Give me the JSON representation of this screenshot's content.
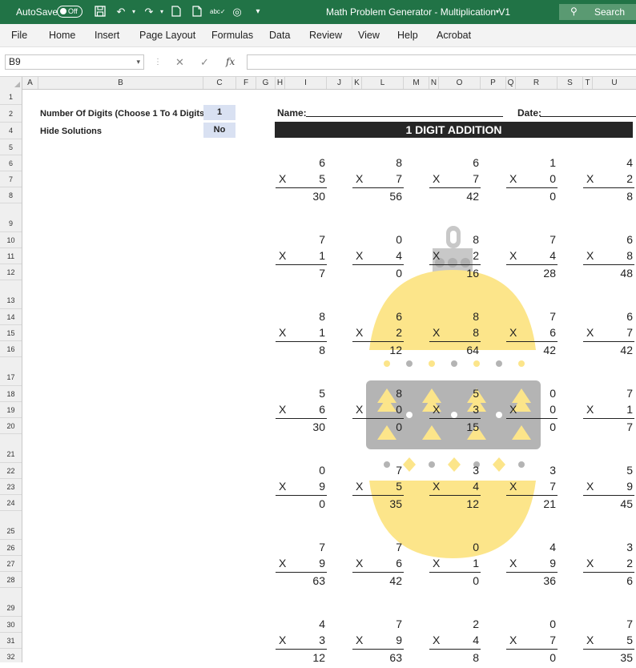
{
  "titlebar": {
    "autosave_label": "AutoSave",
    "autosave_state": "Off",
    "title": "Math Problem Generator - Multiplication V1",
    "search_label": "Search",
    "bg_color": "#217346"
  },
  "ribbon": {
    "tabs": [
      "File",
      "Home",
      "Insert",
      "Page Layout",
      "Formulas",
      "Data",
      "Review",
      "View",
      "Help",
      "Acrobat"
    ]
  },
  "formula_bar": {
    "name_box": "B9",
    "cancel_symbol": "✕",
    "enter_symbol": "✓",
    "fx_symbol": "fx",
    "formula": ""
  },
  "columns": [
    "A",
    "B",
    "C",
    "F",
    "G",
    "H",
    "I",
    "J",
    "K",
    "L",
    "M",
    "N",
    "O",
    "P",
    "Q",
    "R",
    "S",
    "T",
    "U"
  ],
  "rows": [
    "1",
    "2",
    "4",
    "5",
    "6",
    "7",
    "8",
    "9",
    "10",
    "11",
    "12",
    "13",
    "14",
    "15",
    "16",
    "17",
    "18",
    "19",
    "20",
    "21",
    "22",
    "23",
    "24",
    "25",
    "26",
    "27",
    "28",
    "29",
    "30",
    "31",
    "32"
  ],
  "settings": {
    "digits_label": "Number Of Digits (Choose 1 To 4 Digits)",
    "digits_value": "1",
    "hide_label": "Hide Solutions",
    "hide_value": "No",
    "input_fill": "#d9e1f2"
  },
  "worksheet": {
    "name_label": "Name:",
    "date_label": "Date:",
    "banner": "1 DIGIT ADDITION",
    "operator": "X",
    "problems": [
      [
        {
          "a": "6",
          "b": "5",
          "ans": "30"
        },
        {
          "a": "8",
          "b": "7",
          "ans": "56"
        },
        {
          "a": "6",
          "b": "7",
          "ans": "42"
        },
        {
          "a": "1",
          "b": "0",
          "ans": "0"
        },
        {
          "a": "4",
          "b": "2",
          "ans": "8"
        }
      ],
      [
        {
          "a": "7",
          "b": "1",
          "ans": "7"
        },
        {
          "a": "0",
          "b": "4",
          "ans": "0"
        },
        {
          "a": "8",
          "b": "2",
          "ans": "16"
        },
        {
          "a": "7",
          "b": "4",
          "ans": "28"
        },
        {
          "a": "6",
          "b": "8",
          "ans": "48"
        }
      ],
      [
        {
          "a": "8",
          "b": "1",
          "ans": "8"
        },
        {
          "a": "6",
          "b": "2",
          "ans": "12"
        },
        {
          "a": "8",
          "b": "8",
          "ans": "64"
        },
        {
          "a": "7",
          "b": "6",
          "ans": "42"
        },
        {
          "a": "6",
          "b": "7",
          "ans": "42"
        }
      ],
      [
        {
          "a": "5",
          "b": "6",
          "ans": "30"
        },
        {
          "a": "8",
          "b": "0",
          "ans": "0"
        },
        {
          "a": "5",
          "b": "3",
          "ans": "15"
        },
        {
          "a": "0",
          "b": "0",
          "ans": "0"
        },
        {
          "a": "7",
          "b": "1",
          "ans": "7"
        }
      ],
      [
        {
          "a": "0",
          "b": "9",
          "ans": "0"
        },
        {
          "a": "7",
          "b": "5",
          "ans": "35"
        },
        {
          "a": "3",
          "b": "4",
          "ans": "12"
        },
        {
          "a": "3",
          "b": "7",
          "ans": "21"
        },
        {
          "a": "5",
          "b": "9",
          "ans": "45"
        }
      ],
      [
        {
          "a": "7",
          "b": "9",
          "ans": "63"
        },
        {
          "a": "7",
          "b": "6",
          "ans": "42"
        },
        {
          "a": "0",
          "b": "1",
          "ans": "0"
        },
        {
          "a": "4",
          "b": "9",
          "ans": "36"
        },
        {
          "a": "3",
          "b": "2",
          "ans": "6"
        }
      ],
      [
        {
          "a": "4",
          "b": "3",
          "ans": "12"
        },
        {
          "a": "7",
          "b": "9",
          "ans": "63"
        },
        {
          "a": "2",
          "b": "4",
          "ans": "8"
        },
        {
          "a": "0",
          "b": "7",
          "ans": "0"
        },
        {
          "a": "7",
          "b": "5",
          "ans": "35"
        }
      ]
    ]
  },
  "colors": {
    "ornament_yellow": "#fce58a",
    "ornament_gray": "#b4b4b4",
    "ornament_cap": "#c8c8c8",
    "banner_bg": "#262626"
  }
}
